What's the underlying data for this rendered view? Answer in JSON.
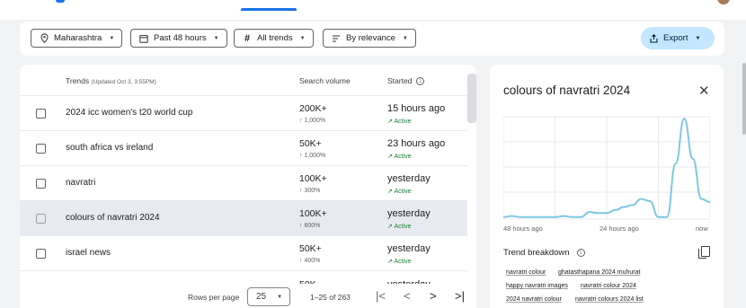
{
  "filters": {
    "location": "Maharashtra",
    "time": "Past 48 hours",
    "category": "All trends",
    "sort": "By relevance",
    "export_label": "Export"
  },
  "table": {
    "col_trends": "Trends",
    "updated": "(Updated Oct 3, 3:55PM)",
    "col_volume": "Search volume",
    "col_started": "Started",
    "rows": [
      {
        "title": "2024 icc women's t20 world cup",
        "volume": "200K+",
        "change": "↑ 1,000%",
        "started": "15 hours ago",
        "status": "Active"
      },
      {
        "title": "south africa vs ireland",
        "volume": "50K+",
        "change": "↑ 1,000%",
        "started": "23 hours ago",
        "status": "Active"
      },
      {
        "title": "navratri",
        "volume": "100K+",
        "change": "↑ 300%",
        "started": "yesterday",
        "status": "Active"
      },
      {
        "title": "colours of navratri 2024",
        "volume": "100K+",
        "change": "↑ 600%",
        "started": "yesterday",
        "status": "Active"
      },
      {
        "title": "israel news",
        "volume": "50K+",
        "change": "↑ 400%",
        "started": "yesterday",
        "status": "Active"
      },
      {
        "title": "",
        "volume": "50K",
        "change": "",
        "started": "yesterday",
        "status": ""
      }
    ]
  },
  "pagination": {
    "rows_per_page_label": "Rows per page",
    "rows_per_page": "25",
    "range": "1–25 of 263"
  },
  "panel": {
    "title": "colours of navratri 2024",
    "x_labels": [
      "48 hours ago",
      "24 hours ago",
      "now"
    ],
    "breakdown_label": "Trend breakdown",
    "keywords": [
      "navratri colour",
      "ghatasthapana 2024 muhurat",
      "happy navratri images",
      "navratri colour 2024",
      "2024 navratri colour",
      "navratri colours 2024 list"
    ],
    "accent": "#7ec8e3"
  },
  "chart_data": {
    "type": "line",
    "x": [
      "48 hours ago",
      "",
      "",
      "",
      "",
      "",
      "",
      "",
      "",
      "",
      "",
      "",
      "24 hours ago",
      "",
      "",
      "",
      "",
      "",
      "",
      "",
      "",
      "",
      "",
      "",
      "now"
    ],
    "series": [
      {
        "values": [
          2,
          3,
          2,
          2,
          2,
          2,
          2,
          3,
          2,
          2,
          7,
          6,
          6,
          9,
          12,
          14,
          20,
          18,
          2,
          2,
          55,
          100,
          60,
          20,
          17
        ]
      }
    ],
    "ylim": [
      0,
      100
    ],
    "grid": true
  },
  "icons": [
    "location-pin-icon",
    "calendar-icon",
    "hash-icon",
    "sort-icon",
    "export-icon",
    "info-icon",
    "trending-up-icon",
    "close-icon",
    "copy-icon",
    "first-page-icon",
    "prev-page-icon",
    "next-page-icon",
    "last-page-icon"
  ]
}
